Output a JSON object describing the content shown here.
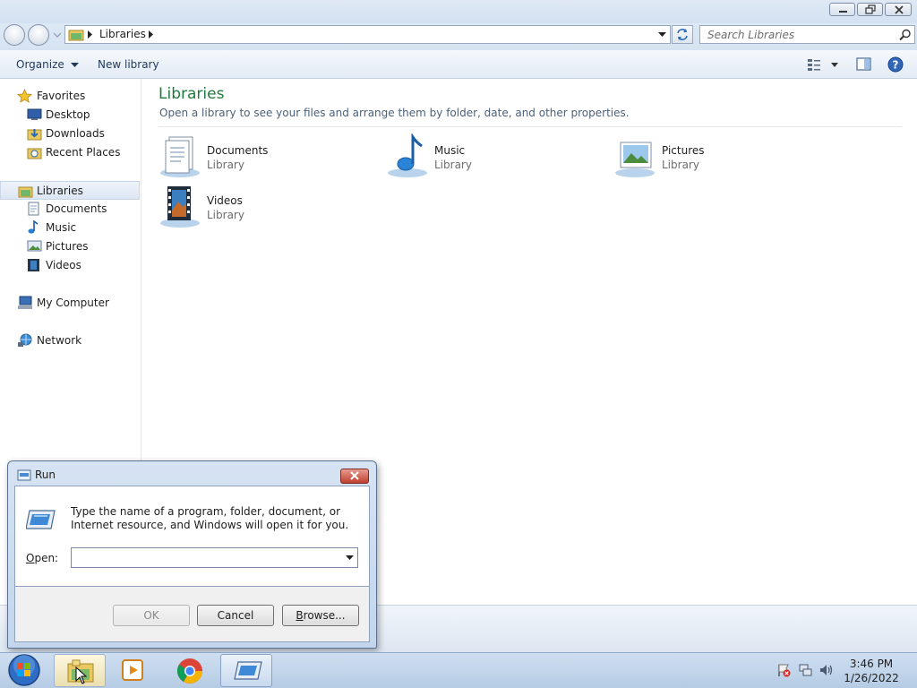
{
  "address": {
    "path_label": "Libraries"
  },
  "search": {
    "placeholder": "Search Libraries"
  },
  "toolbar": {
    "organize_label": "Organize",
    "new_library_label": "New library"
  },
  "navpane": {
    "favorites": {
      "label": "Favorites",
      "items": [
        {
          "label": "Desktop",
          "icon": "desktop-icon"
        },
        {
          "label": "Downloads",
          "icon": "downloads-folder-icon"
        },
        {
          "label": "Recent Places",
          "icon": "recent-places-icon"
        }
      ]
    },
    "libraries": {
      "label": "Libraries",
      "items": [
        {
          "label": "Documents",
          "icon": "documents-icon"
        },
        {
          "label": "Music",
          "icon": "music-icon"
        },
        {
          "label": "Pictures",
          "icon": "pictures-icon"
        },
        {
          "label": "Videos",
          "icon": "videos-icon"
        }
      ]
    },
    "computer": {
      "label": "My Computer"
    },
    "network": {
      "label": "Network"
    }
  },
  "main": {
    "title": "Libraries",
    "subtitle": "Open a library to see your files and arrange them by folder, date, and other properties.",
    "libraries": [
      {
        "name": "Documents",
        "type": "Library",
        "icon": "documents-library-icon"
      },
      {
        "name": "Music",
        "type": "Library",
        "icon": "music-library-icon"
      },
      {
        "name": "Pictures",
        "type": "Library",
        "icon": "pictures-library-icon"
      },
      {
        "name": "Videos",
        "type": "Library",
        "icon": "videos-library-icon"
      }
    ]
  },
  "run_dialog": {
    "title": "Run",
    "description": "Type the name of a program, folder, document, or Internet resource, and Windows will open it for you.",
    "open_label_key": "O",
    "open_label_rest": "pen:",
    "open_value": "",
    "ok_label": "OK",
    "cancel_label": "Cancel",
    "browse_label_key": "B",
    "browse_label_rest": "rowse..."
  },
  "taskbar": {
    "time": "3:46 PM",
    "date": "1/26/2022"
  },
  "colors": {
    "library_title": "#1e7a3c",
    "selection": "#dce6f3",
    "taskbar": "#c3d5ec"
  }
}
